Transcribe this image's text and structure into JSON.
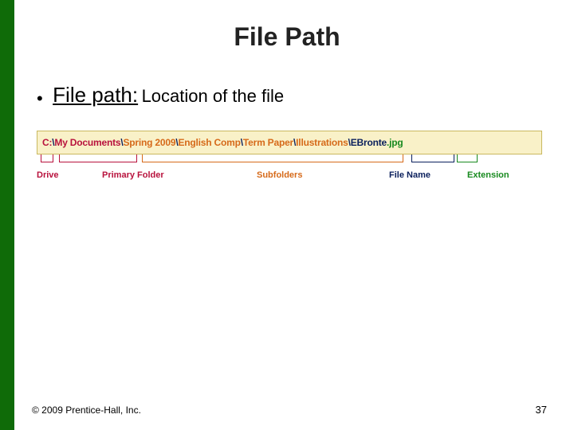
{
  "title": "File Path",
  "bullet": {
    "marker": "•",
    "term": "File path:",
    "desc": " Location of the file"
  },
  "path": {
    "drive": "C:",
    "sep1": "\\",
    "primary": "My Documents",
    "sep2": "\\",
    "sub1": "Spring 2009",
    "sep3": "\\",
    "sub2": "English Comp",
    "sep4": "\\",
    "sub3": "Term Paper",
    "sep5": "\\",
    "sub4": "Illustrations",
    "sep6": "\\",
    "filename": "EBronte",
    "ext": ".jpg"
  },
  "labels": {
    "drive": "Drive",
    "primary": "Primary Folder",
    "subfolders": "Subfolders",
    "filename": "File Name",
    "extension": "Extension"
  },
  "footer": {
    "copyright": "© 2009 Prentice-Hall, Inc.",
    "page": "37"
  }
}
